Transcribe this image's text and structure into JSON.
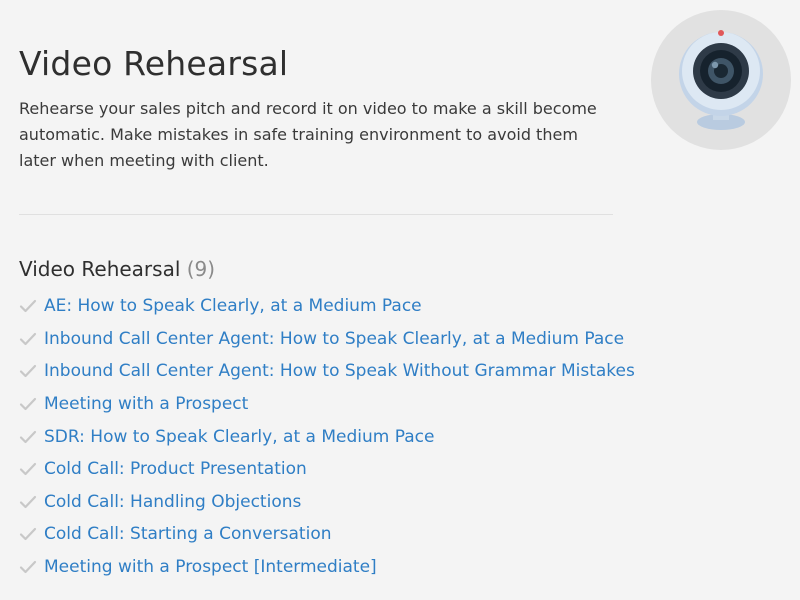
{
  "header": {
    "title": "Video Rehearsal",
    "description": "Rehearse your sales pitch and record it on video to make a skill become automatic. Make mistakes in safe training environment to avoid them later when meeting with client.",
    "hero_icon": "webcam-icon"
  },
  "section": {
    "title": "Video Rehearsal",
    "count": "(9)",
    "item_icon": "check-icon",
    "items": [
      {
        "label": "AE: How to Speak Clearly, at a Medium Pace"
      },
      {
        "label": "Inbound Call Center Agent: How to Speak Clearly, at a Medium Pace"
      },
      {
        "label": "Inbound Call Center Agent: How to Speak Without Grammar Mistakes"
      },
      {
        "label": "Meeting with a Prospect"
      },
      {
        "label": "SDR: How to Speak Clearly, at a Medium Pace"
      },
      {
        "label": "Cold Call: Product Presentation"
      },
      {
        "label": "Cold Call: Handling Objections"
      },
      {
        "label": "Cold Call: Starting a Conversation"
      },
      {
        "label": "Meeting with a Prospect [Intermediate]"
      }
    ]
  },
  "colors": {
    "background": "#f4f4f4",
    "link": "#2f7ec5",
    "check": "#c8c8c8",
    "text": "#333333"
  }
}
